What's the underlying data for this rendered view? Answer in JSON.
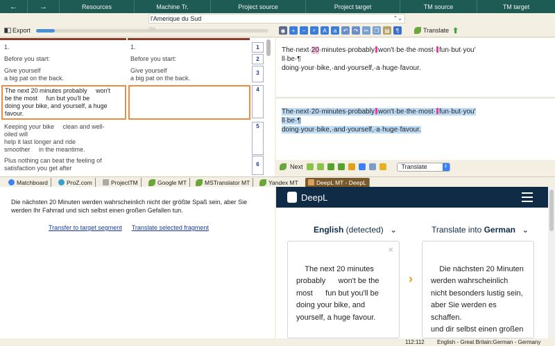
{
  "menu": {
    "back": "←",
    "forward": "→",
    "items": [
      "Resources",
      "Machine Tr.",
      "Project source",
      "Project target",
      "TM source",
      "TM target"
    ]
  },
  "project": {
    "name": "l'Amerique du Sud"
  },
  "toolbar": {
    "export_label": "Export",
    "progress_pct": 0.08,
    "progress_text": "0%",
    "translate_label": "Translate"
  },
  "segments": [
    {
      "num": "1",
      "source": "1.",
      "target": "1."
    },
    {
      "num": "2",
      "source": "Before you start:",
      "target": "Before you start:"
    },
    {
      "num": "3",
      "source": "Give yourself\na big pat on the back.",
      "target": "Give yourself\na big pat on the back."
    },
    {
      "num": "4",
      "source": "The next 20 minutes probably     won't\nbe the most     fun but you'll be\ndoing your bike, and yourself, a huge\nfavour.",
      "target": ""
    },
    {
      "num": "5",
      "source": "Keeping your bike     clean and well-\noiled will\nhelp it last longer and ride\nsmoother     in the meantime.",
      "target": ""
    },
    {
      "num": "6",
      "source": "Plus nothing can beat the feeling of\nsatisfaction you get after",
      "target": ""
    }
  ],
  "editor": {
    "source_line1_a": "The·next·",
    "source_line1_tag": "20",
    "source_line1_b": "·minutes·probably",
    "source_line1_c": "won't·be·the·most·",
    "source_line1_d": "fun·but·you'",
    "source_line2": "ll·be·¶",
    "source_line3": "doing·your·bike,·and·yourself,·a·huge·favour.",
    "target_line1_a": "The·next·20·minutes·probably",
    "target_line1_b": "won't·be·the·most·",
    "target_line1_c": "fun·but·you'",
    "target_line2": "ll·be·¶",
    "target_line3": "doing·your·bike,·and·yourself,·a·huge·favour.",
    "next_label": "Next",
    "translate_select": "Translate"
  },
  "tabs": [
    "Matchboard",
    "ProZ.com",
    "ProjectTM",
    "Google MT",
    "MSTranslator MT",
    "Yandex MT",
    "DeepL MT - DeepL"
  ],
  "mt": {
    "result": "Die nächsten 20 Minuten werden wahrscheinlich nicht der größte Spaß sein, aber Sie werden Ihr Fahrrad und sich selbst einen großen Gefallen tun.",
    "transfer_link": "Transfer to target segment",
    "translate_fragment_link": "Translate selected fragment"
  },
  "deepl": {
    "brand": "DeepL",
    "source_lang_bold": "English",
    "source_lang_rest": " (detected)",
    "target_lang_prefix": "Translate into ",
    "target_lang_bold": "German",
    "source_text": "The next 20 minutes\nprobably      won't be the\nmost      fun but you'll be\ndoing your bike, and\nyourself, a huge favour.",
    "target_text": "Die nächsten 20 Minuten\nwerden wahrscheinlich\nnicht besonders lustig sein,\naber Sie werden es\nschaffen.\nund dir selbst einen großen\nGefallen tun.",
    "close_glyph": "×"
  },
  "status": {
    "position": "112:112",
    "languages": "English - Great Britain:German - Germany"
  },
  "colors": {
    "menubar": "#1f5b55",
    "deepl_navy": "#0f2b46",
    "active_segment": "#f08a40",
    "highlight": "#bfdcf5"
  }
}
